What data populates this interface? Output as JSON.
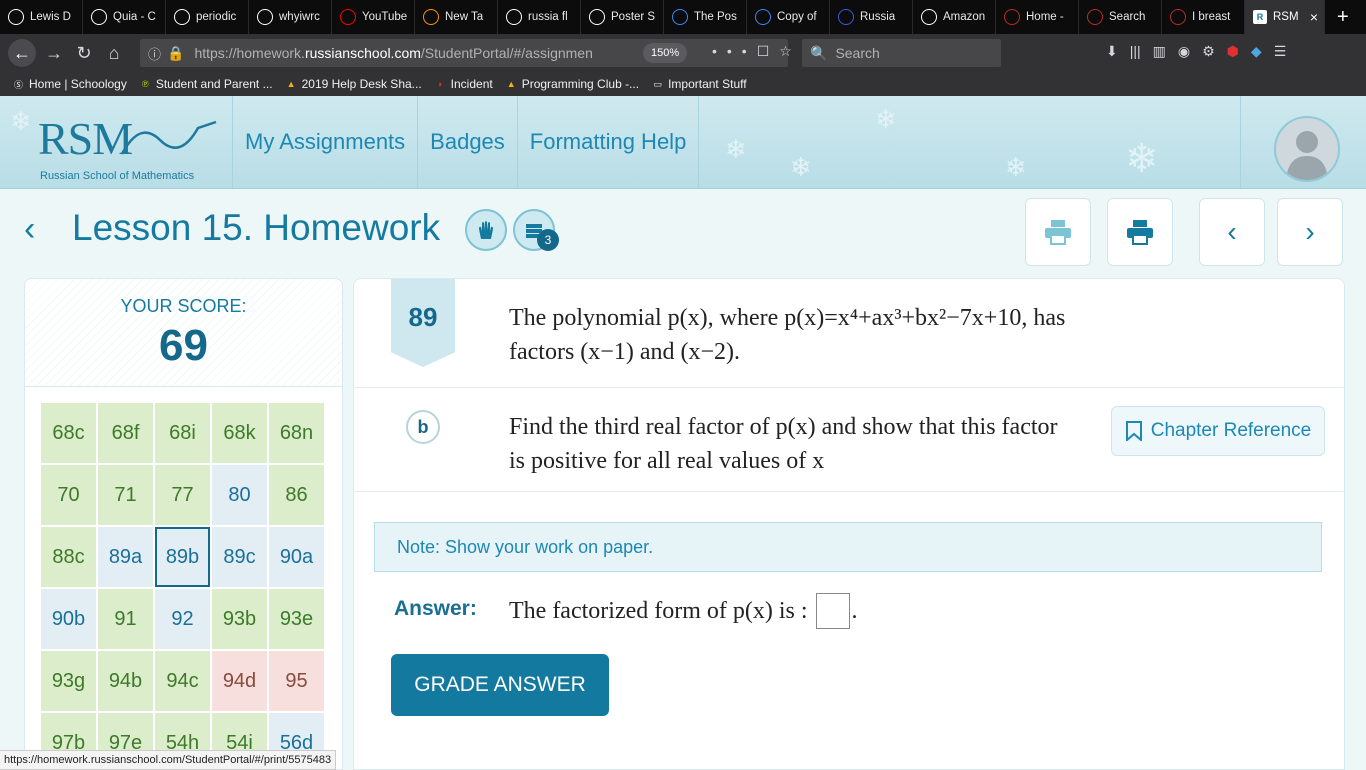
{
  "browser": {
    "tabs": [
      {
        "label": "Lewis D",
        "icon": "schoology-icon",
        "color": "#ffffff"
      },
      {
        "label": "Quia - C",
        "icon": "quia-icon",
        "color": "#ffffff"
      },
      {
        "label": "periodic",
        "icon": "google-icon",
        "color": "#ffffff"
      },
      {
        "label": "whyiwrc",
        "icon": "schoology-icon",
        "color": "#ffffff"
      },
      {
        "label": "YouTube",
        "icon": "youtube-icon",
        "color": "#ff0000"
      },
      {
        "label": "New Ta",
        "icon": "firefox-icon",
        "color": "#ff9500"
      },
      {
        "label": "russia fl",
        "icon": "google-icon",
        "color": "#ffffff"
      },
      {
        "label": "Poster S",
        "icon": "schoology-icon",
        "color": "#ffffff"
      },
      {
        "label": "The Pos",
        "icon": "docs-icon",
        "color": "#4285f4"
      },
      {
        "label": "Copy of",
        "icon": "docs-icon",
        "color": "#4285f4"
      },
      {
        "label": "Russia",
        "icon": "globe-icon",
        "color": "#3b5bdb"
      },
      {
        "label": "Amazon",
        "icon": "amazon-icon",
        "color": "#ffffff"
      },
      {
        "label": "Home -",
        "icon": "quora-icon",
        "color": "#b92b27"
      },
      {
        "label": "Search",
        "icon": "quora-icon",
        "color": "#b92b27"
      },
      {
        "label": "I breast",
        "icon": "quora-icon",
        "color": "#b92b27"
      }
    ],
    "active_tab": "RSM",
    "url_prefix": "https://homework.",
    "url_domain": "russianschool.com",
    "url_suffix": "/StudentPortal/#/assignmen",
    "zoom": "150%",
    "search_placeholder": "Search",
    "bookmarks": [
      {
        "label": "Home | Schoology",
        "icon": "schoology-icon"
      },
      {
        "label": "Student and Parent ...",
        "icon": "p-icon"
      },
      {
        "label": "2019 Help Desk Sha...",
        "icon": "drive-icon"
      },
      {
        "label": "Incident",
        "icon": "incident-icon"
      },
      {
        "label": "Programming Club -...",
        "icon": "drive-icon"
      },
      {
        "label": "Important Stuff",
        "icon": "folder-icon"
      }
    ],
    "status_url": "https://homework.russianschool.com/StudentPortal/#/print/5575483"
  },
  "header": {
    "logo_text": "RSM",
    "logo_subtitle": "Russian School of Mathematics",
    "nav": [
      "My Assignments",
      "Badges",
      "Formatting Help"
    ]
  },
  "lesson": {
    "title": "Lesson 15. Homework",
    "badge_count": "3"
  },
  "score": {
    "label": "YOUR SCORE:",
    "value": "69",
    "problems": [
      {
        "id": "68c",
        "state": "green"
      },
      {
        "id": "68f",
        "state": "green"
      },
      {
        "id": "68i",
        "state": "green"
      },
      {
        "id": "68k",
        "state": "green"
      },
      {
        "id": "68n",
        "state": "green"
      },
      {
        "id": "70",
        "state": "green"
      },
      {
        "id": "71",
        "state": "green"
      },
      {
        "id": "77",
        "state": "green"
      },
      {
        "id": "80",
        "state": "blue"
      },
      {
        "id": "86",
        "state": "green"
      },
      {
        "id": "88c",
        "state": "green"
      },
      {
        "id": "89a",
        "state": "blue"
      },
      {
        "id": "89b",
        "state": "selected"
      },
      {
        "id": "89c",
        "state": "blue"
      },
      {
        "id": "90a",
        "state": "blue"
      },
      {
        "id": "90b",
        "state": "blue"
      },
      {
        "id": "91",
        "state": "green"
      },
      {
        "id": "92",
        "state": "blue"
      },
      {
        "id": "93b",
        "state": "green"
      },
      {
        "id": "93e",
        "state": "green"
      },
      {
        "id": "93g",
        "state": "green"
      },
      {
        "id": "94b",
        "state": "green"
      },
      {
        "id": "94c",
        "state": "green"
      },
      {
        "id": "94d",
        "state": "red"
      },
      {
        "id": "95",
        "state": "red"
      },
      {
        "id": "97b",
        "state": "green"
      },
      {
        "id": "97e",
        "state": "green"
      },
      {
        "id": "54h",
        "state": "green"
      },
      {
        "id": "54i",
        "state": "green"
      },
      {
        "id": "56d",
        "state": "blue"
      }
    ]
  },
  "question": {
    "number": "89",
    "stem_line1": "The polynomial p(x), where p(x)=x⁴+ax³+bx²−7x+10, has",
    "stem_line2": "factors (x−1) and (x−2).",
    "part": "b",
    "part_line1": "Find the third real factor of p(x) and show that this factor",
    "part_line2": "is positive for all real values of x",
    "chapter_reference": "Chapter Reference",
    "note": "Note: Show your work on paper.",
    "answer_label": "Answer:",
    "answer_text": "The factorized form of p(x) is :",
    "answer_end": ".",
    "grade_button": "GRADE ANSWER"
  },
  "colors": {
    "accent": "#157aa0",
    "button": "#14799e",
    "correct": "#dbedca",
    "incorrect": "#f6dfdc",
    "unanswered": "#e2eef3"
  }
}
